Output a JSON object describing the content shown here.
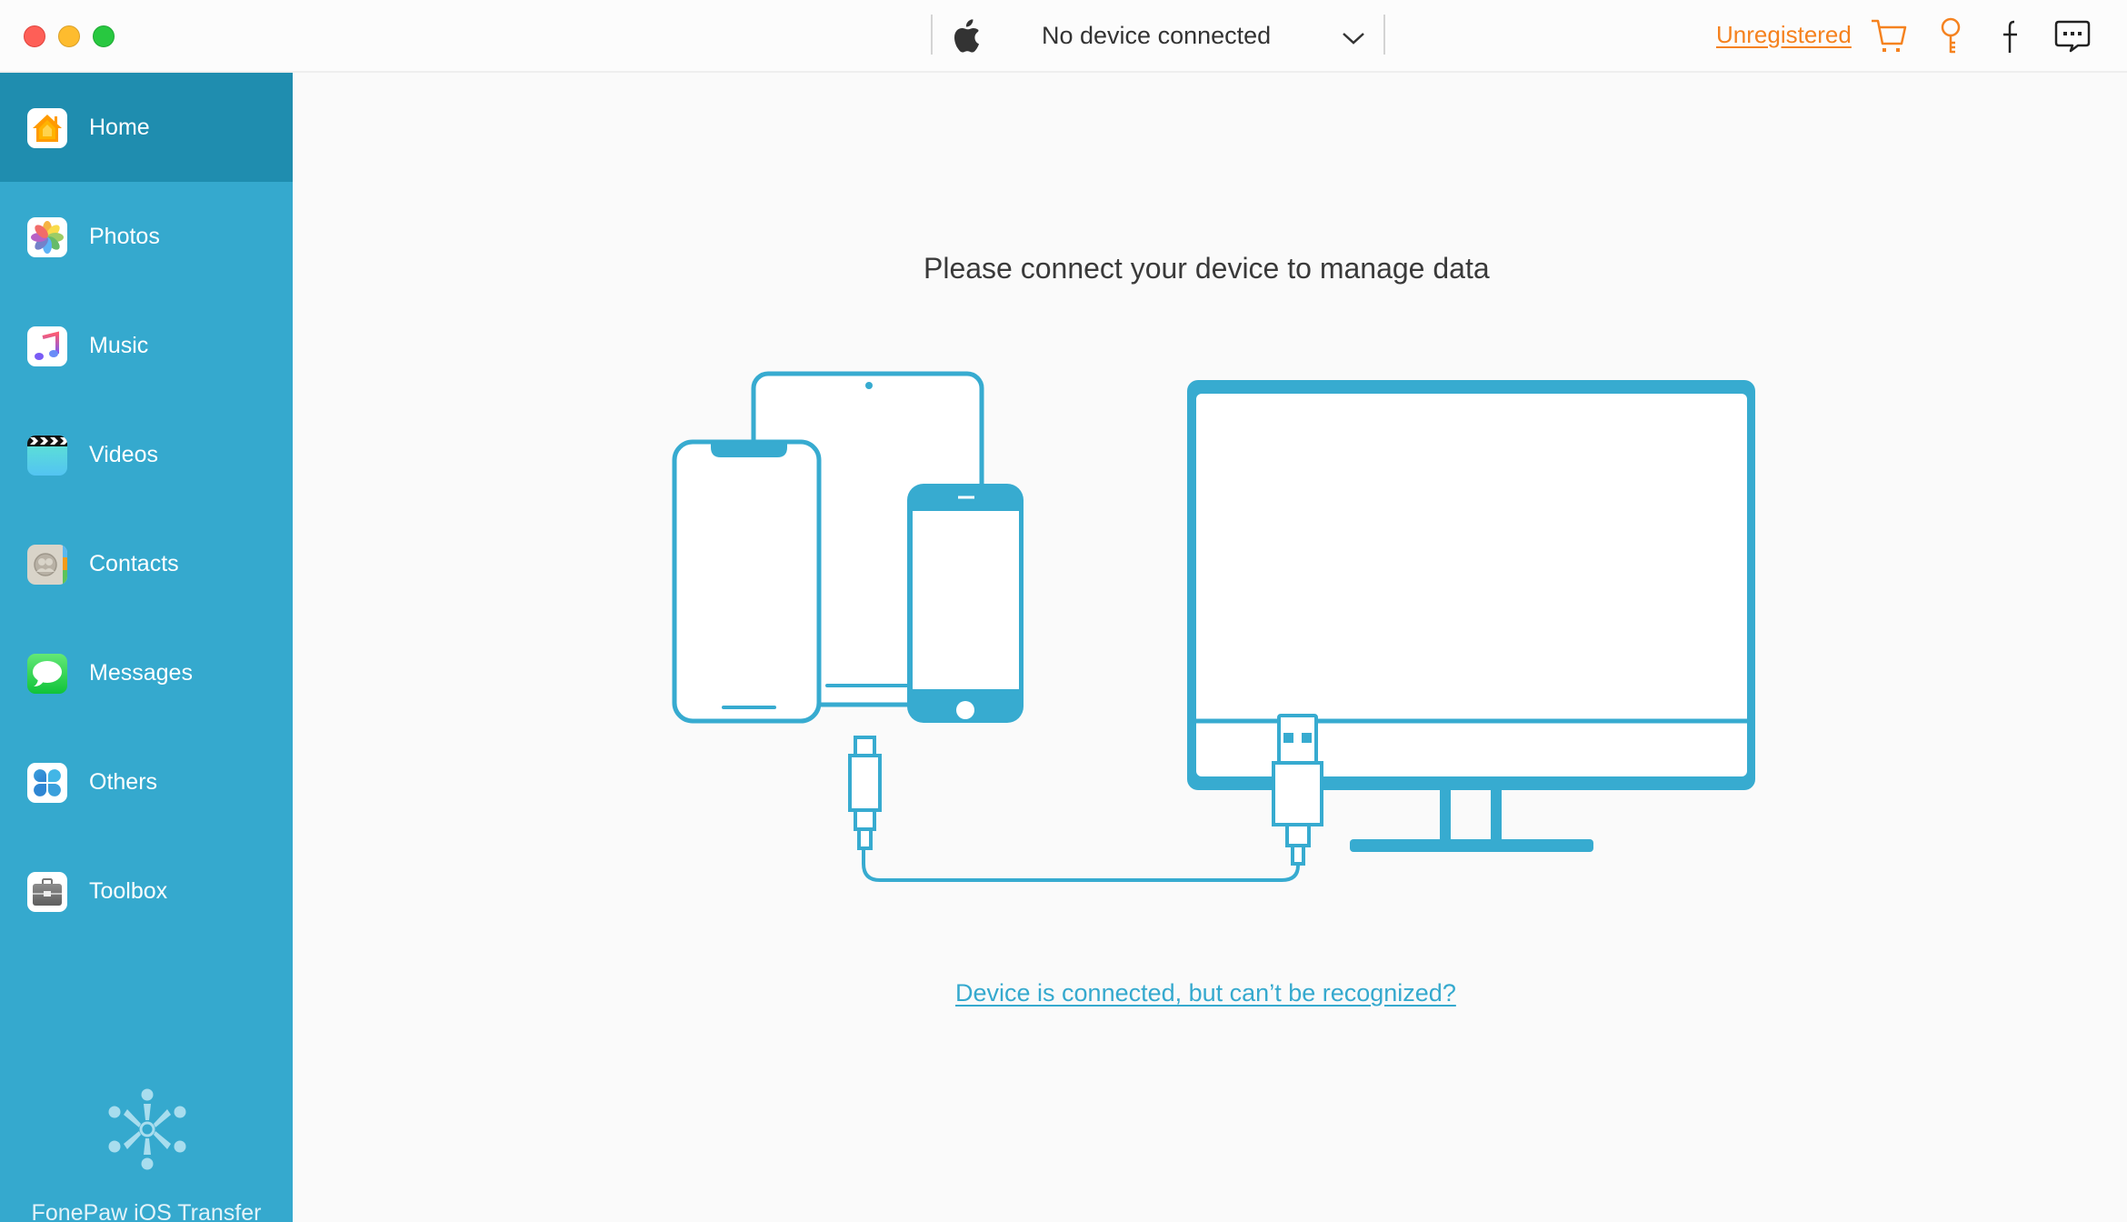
{
  "window": {
    "controls": [
      "close",
      "minimize",
      "maximize"
    ]
  },
  "header": {
    "device_icon": "apple-icon",
    "device_select": {
      "selected": "No device connected",
      "icon": "chevron-down-icon"
    },
    "registration_link": "Unregistered",
    "actions": [
      {
        "name": "cart-icon",
        "color": "#f5821f"
      },
      {
        "name": "key-icon",
        "color": "#f5821f"
      },
      {
        "name": "facebook-icon",
        "color": "#222222"
      },
      {
        "name": "feedback-chat-icon",
        "color": "#222222"
      }
    ]
  },
  "sidebar": {
    "items": [
      {
        "label": "Home",
        "icon": "home-icon",
        "active": true
      },
      {
        "label": "Photos",
        "icon": "photos-icon",
        "active": false
      },
      {
        "label": "Music",
        "icon": "music-icon",
        "active": false
      },
      {
        "label": "Videos",
        "icon": "videos-icon",
        "active": false
      },
      {
        "label": "Contacts",
        "icon": "contacts-icon",
        "active": false
      },
      {
        "label": "Messages",
        "icon": "messages-icon",
        "active": false
      },
      {
        "label": "Others",
        "icon": "others-icon",
        "active": false
      },
      {
        "label": "Toolbox",
        "icon": "toolbox-icon",
        "active": false
      }
    ],
    "brand": {
      "logo": "fonepaw-logo-icon",
      "name": "FonePaw iOS Transfer"
    }
  },
  "main": {
    "headline": "Please connect your device to manage data",
    "illustration": "devices-connected-to-computer-via-usb",
    "help_link": "Device is connected, but can’t be recognized?"
  },
  "colors": {
    "sidebar": "#35a9ce",
    "sidebar_active": "#1f8daf",
    "accent": "#35a9ce",
    "warning_orange": "#f5821f",
    "background": "#fafafa"
  }
}
